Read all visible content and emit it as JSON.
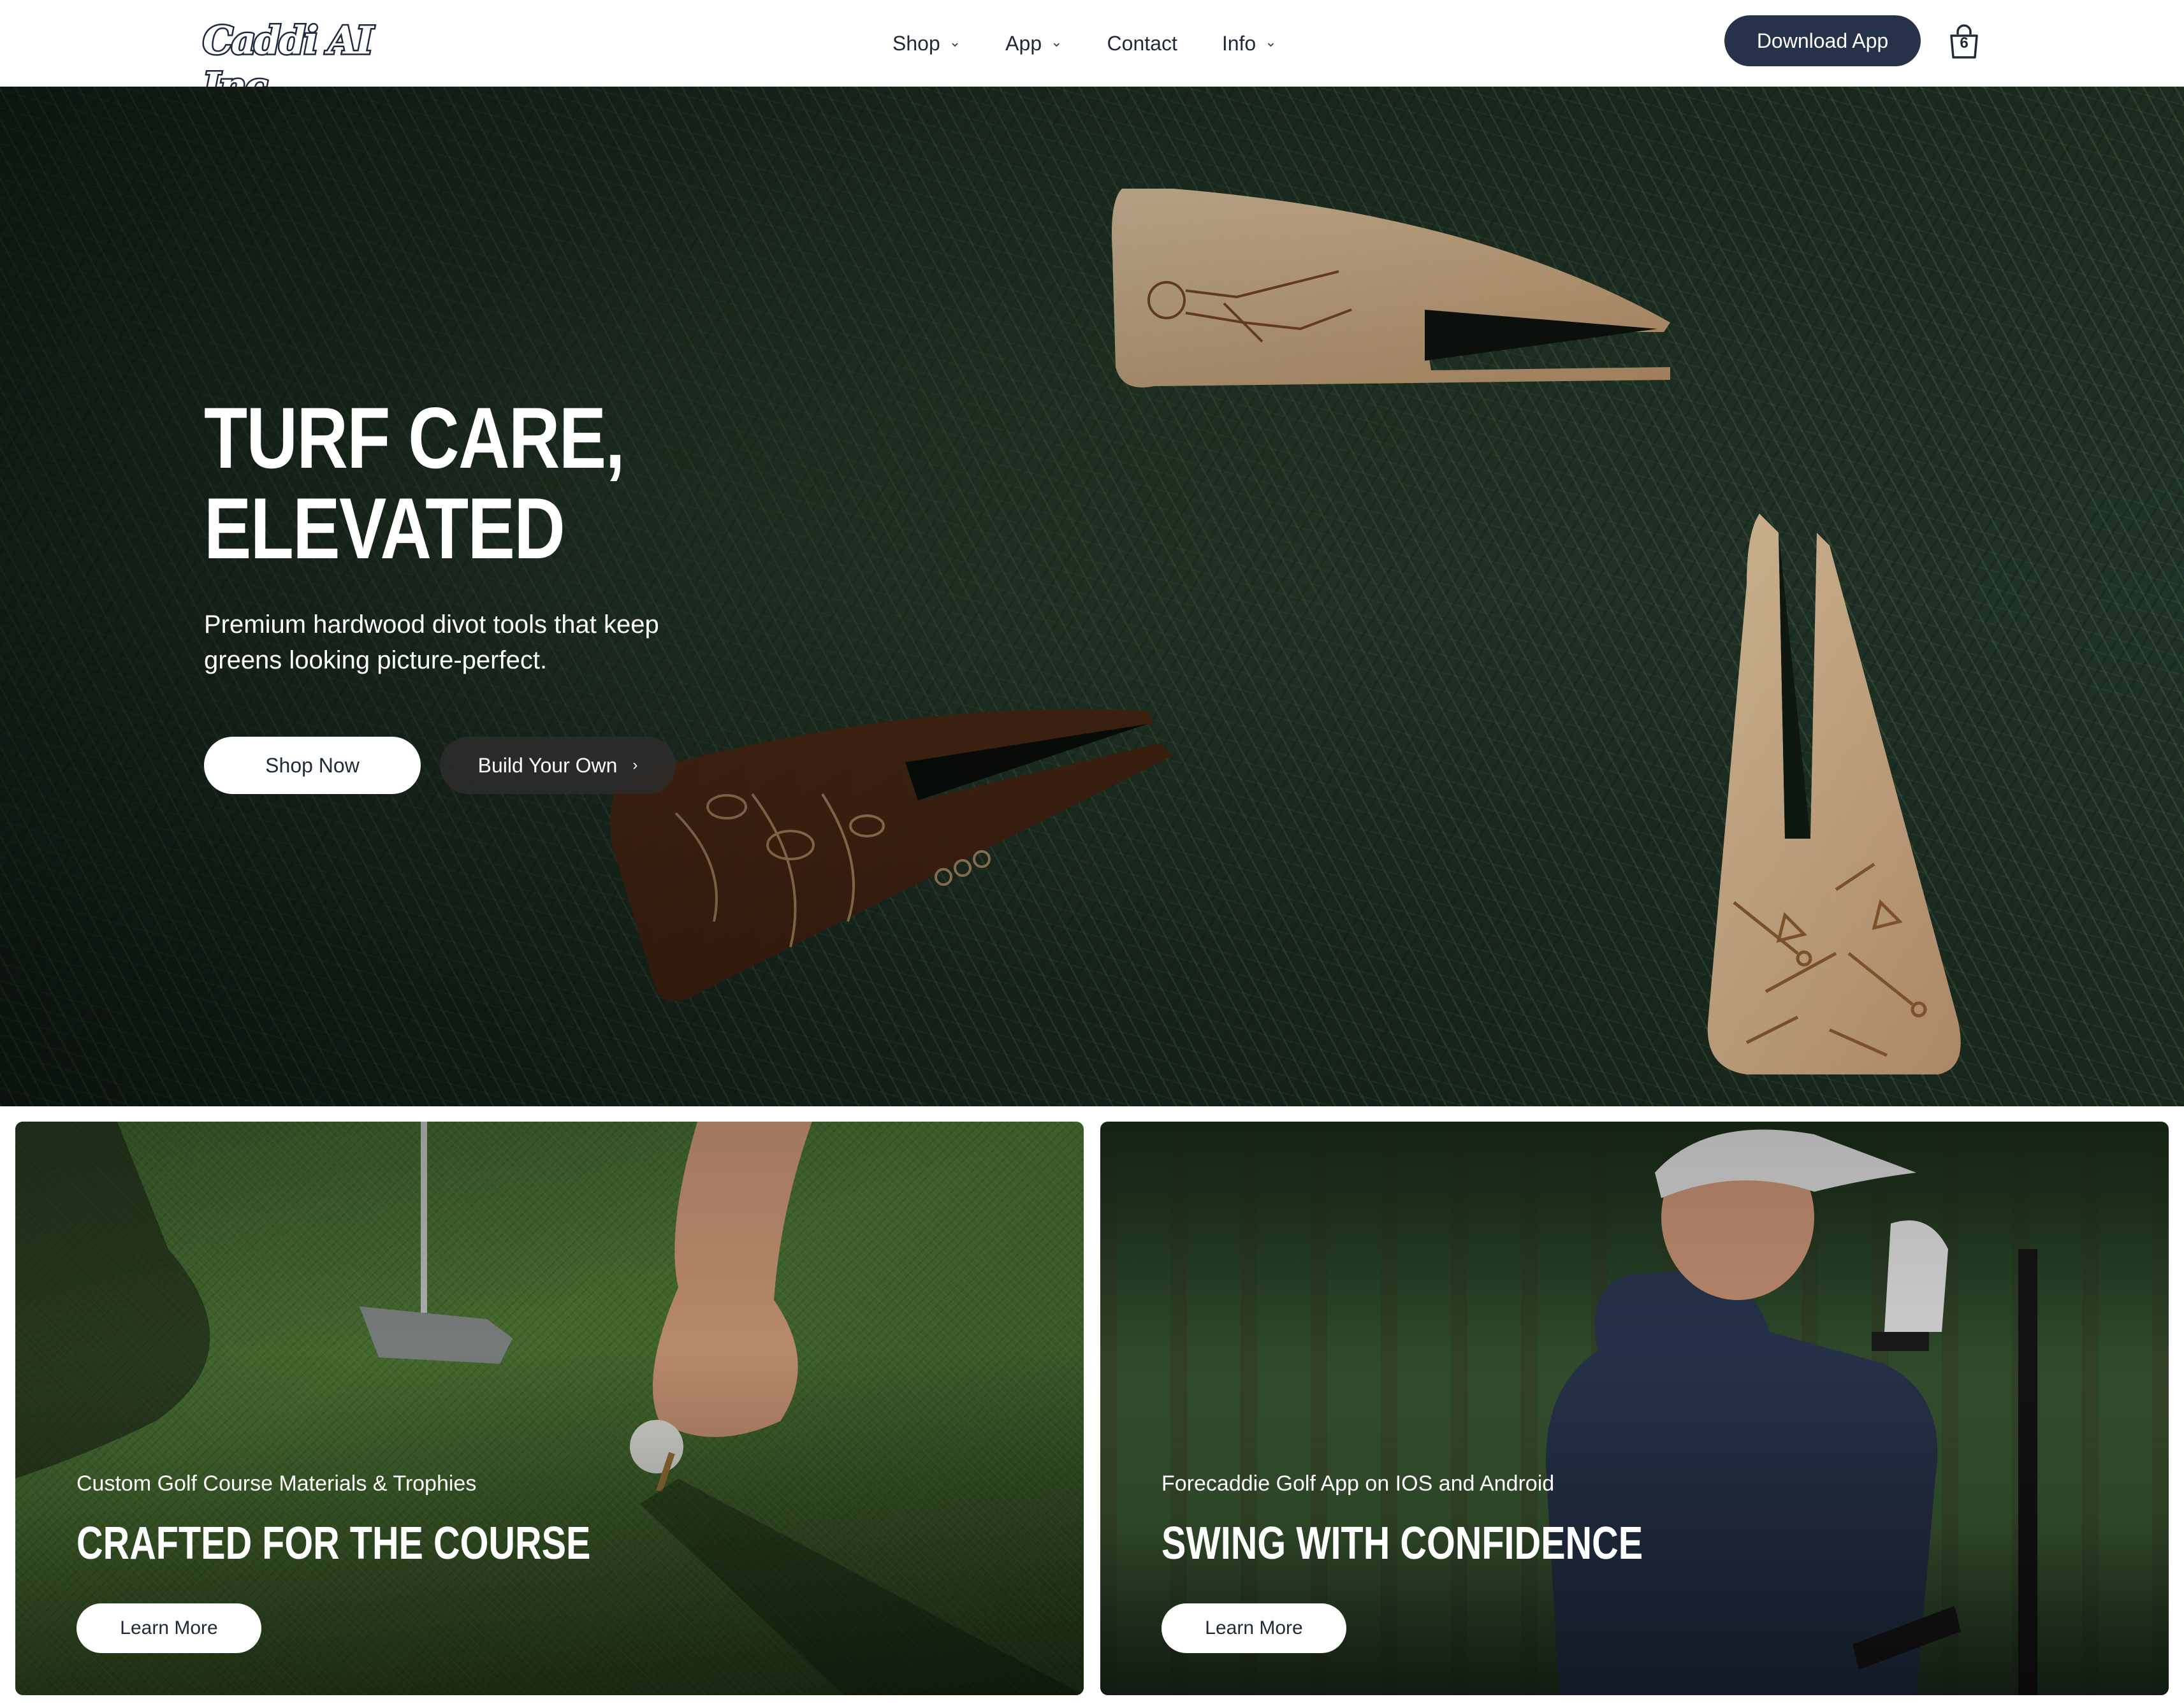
{
  "header": {
    "logo_text": "Caddi AI Inc",
    "nav": [
      {
        "label": "Shop",
        "has_dropdown": true
      },
      {
        "label": "App",
        "has_dropdown": true
      },
      {
        "label": "Contact",
        "has_dropdown": false
      },
      {
        "label": "Info",
        "has_dropdown": true
      }
    ],
    "download_label": "Download App",
    "cart_count": "6"
  },
  "hero": {
    "title_line1": "TURF CARE,",
    "title_line2": "ELEVATED",
    "subtitle": "Premium hardwood divot tools that keep greens looking picture-perfect.",
    "primary_button": "Shop Now",
    "secondary_button": "Build Your Own"
  },
  "cards": [
    {
      "eyebrow": "Custom Golf Course Materials & Trophies",
      "title": "CRAFTED FOR THE COURSE",
      "button": "Learn More"
    },
    {
      "eyebrow": "Forecaddie Golf App on IOS and Android",
      "title": "SWING WITH CONFIDENCE",
      "button": "Learn More"
    }
  ],
  "icons": {
    "cart": "shopping-bag-icon",
    "chevron": "chevron-down-icon",
    "arrow": "chevron-right-icon"
  },
  "colors": {
    "brand_navy": "#253249",
    "text_dark": "#1f2937",
    "white": "#ffffff"
  }
}
